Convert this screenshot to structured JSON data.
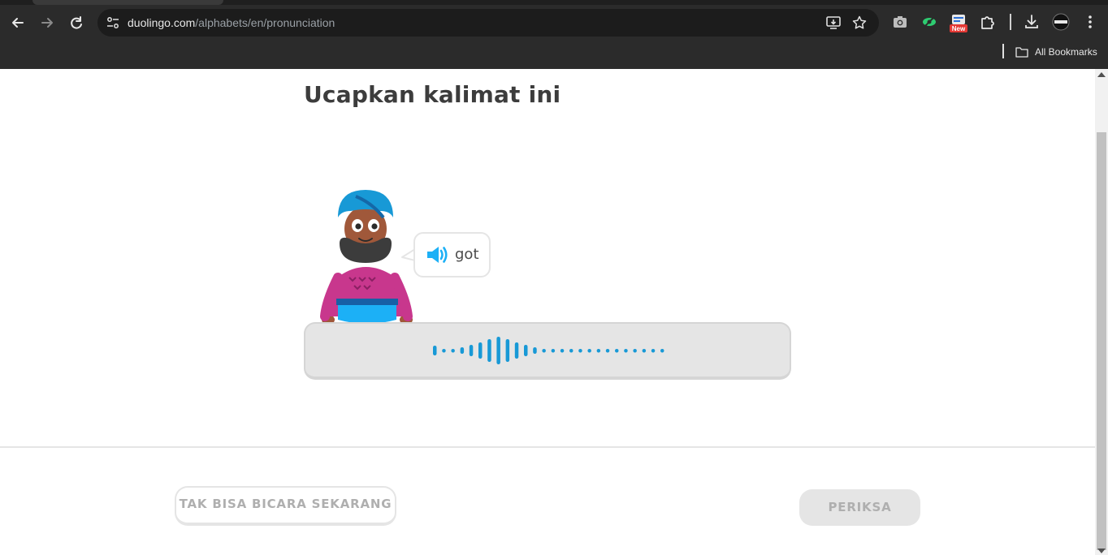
{
  "browser": {
    "url_domain": "duolingo.com",
    "url_path": "/alphabets/en/pronunciation",
    "bookmarks_label": "All Bookmarks",
    "extension_badge": "New"
  },
  "lesson": {
    "title": "Ucapkan kalimat ini",
    "bubble_word": "got",
    "skip_button": "TAK BISA BICARA SEKARANG",
    "check_button": "PERIKSA"
  },
  "colors": {
    "accent_blue": "#1cb0f6",
    "wave_blue": "#1899d6",
    "text_dark": "#3c3c3c",
    "muted": "#afafaf",
    "border": "#e5e5e5"
  },
  "icons": [
    "back-icon",
    "forward-icon",
    "reload-icon",
    "site-info-icon",
    "install-icon",
    "star-icon",
    "camera-icon",
    "eye-extension-icon",
    "new-extension-icon",
    "puzzle-icon",
    "download-icon",
    "profile-avatar",
    "more-icon",
    "folder-icon",
    "speaker-icon"
  ]
}
